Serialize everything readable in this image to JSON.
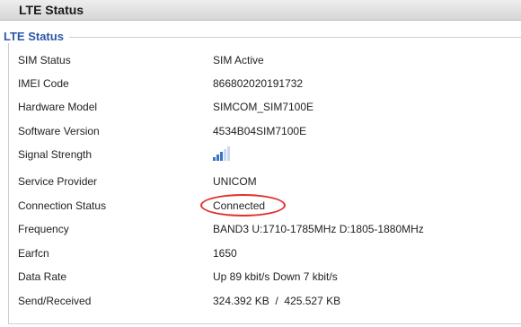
{
  "header": {
    "title": "LTE Status"
  },
  "section": {
    "legend": "LTE Status"
  },
  "rows": [
    {
      "label": "SIM Status",
      "value": "SIM Active"
    },
    {
      "label": "IMEI Code",
      "value": "866802020191732"
    },
    {
      "label": "Hardware Model",
      "value": "SIMCOM_SIM7100E"
    },
    {
      "label": "Software Version",
      "value": "4534B04SIM7100E"
    },
    {
      "label": "Signal Strength",
      "value": "",
      "signal_bars_active": 3,
      "signal_bars_total": 5
    },
    {
      "label": "Service Provider",
      "value": "UNICOM"
    },
    {
      "label": "Connection Status",
      "value": "Connected"
    },
    {
      "label": "Frequency",
      "value": "BAND3 U:1710-1785MHz D:1805-1880MHz"
    },
    {
      "label": "Earfcn",
      "value": "1650"
    },
    {
      "label": "Data Rate",
      "value": "Up 89 kbit/s Down 7 kbit/s"
    },
    {
      "label": "Send/Received",
      "value": "324.392 KB  /  425.527 KB"
    }
  ],
  "colors": {
    "accent": "#2b57a8",
    "highlight": "#e0302a",
    "signal_on": "#3a72c6",
    "signal_off": "#c9d8ee"
  }
}
